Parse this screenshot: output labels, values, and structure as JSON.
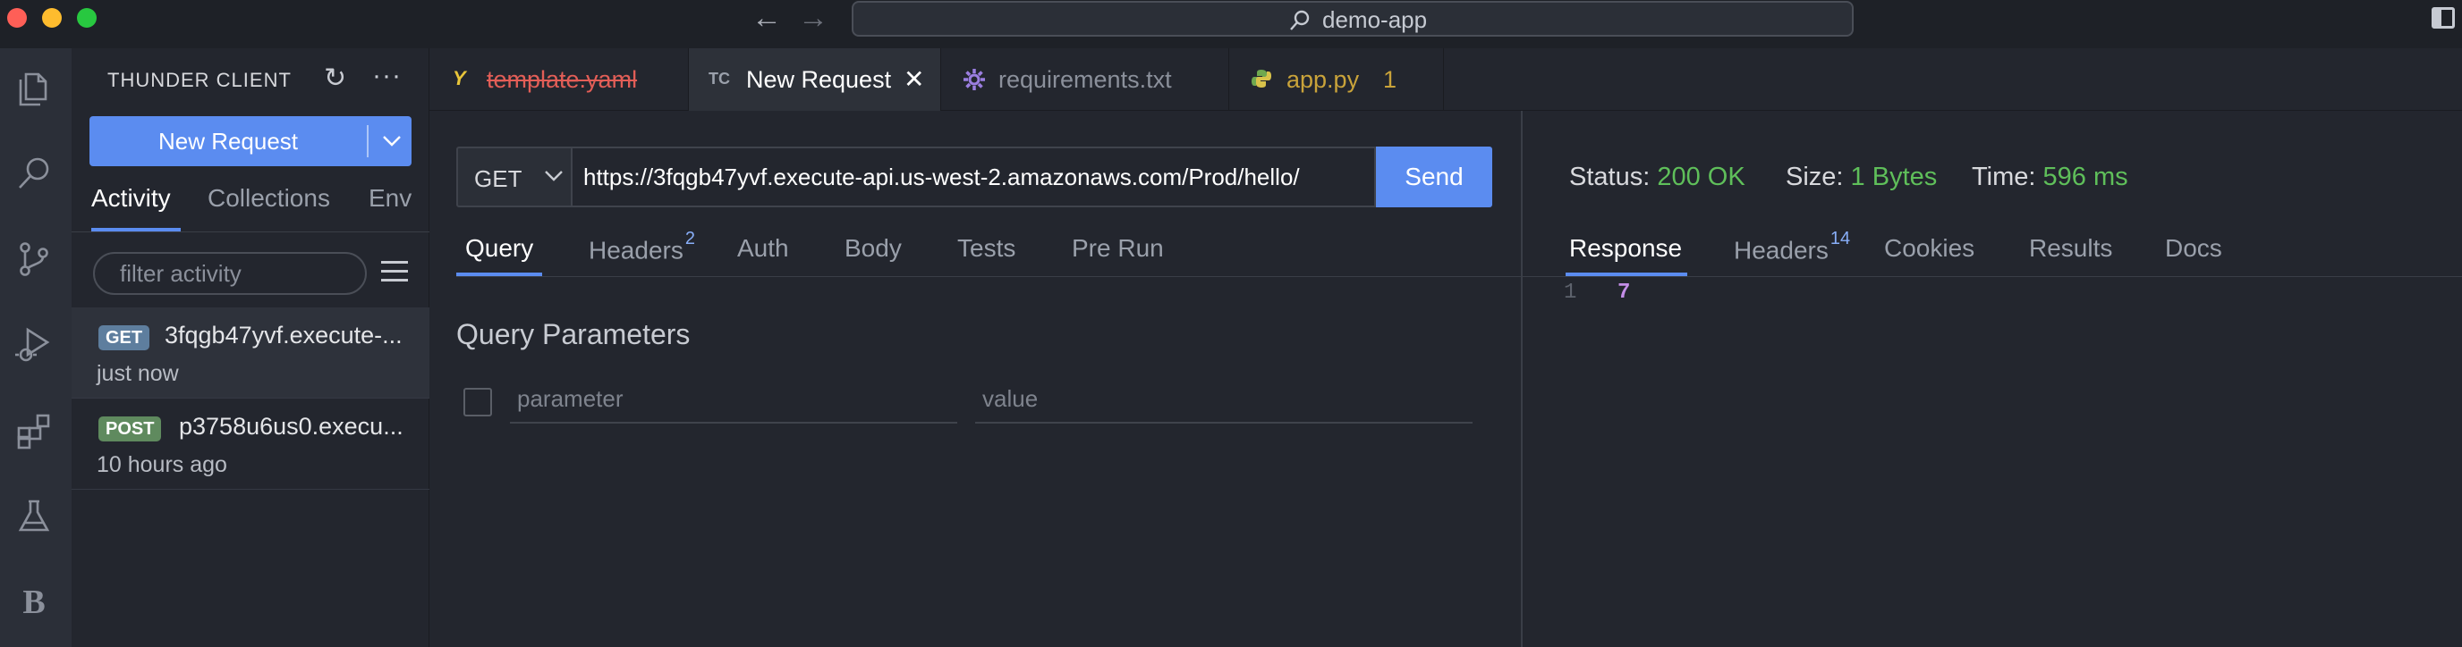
{
  "titlebar": {
    "search_text": "demo-app"
  },
  "activitybar": {
    "items": [
      "explorer-icon",
      "search-icon",
      "source-control-icon",
      "run-debug-icon",
      "extensions-icon",
      "testing-icon",
      "b-icon"
    ],
    "b_label": "B"
  },
  "sidebar": {
    "title": "THUNDER CLIENT",
    "new_request_label": "New Request",
    "tabs": [
      {
        "label": "Activity",
        "active": true
      },
      {
        "label": "Collections",
        "active": false
      },
      {
        "label": "Env",
        "active": false
      }
    ],
    "filter_placeholder": "filter activity",
    "history": [
      {
        "method": "GET",
        "url": "3fqgb47yvf.execute-...",
        "time": "just now",
        "selected": true
      },
      {
        "method": "POST",
        "url": "p3758u6us0.execu...",
        "time": "10 hours ago",
        "selected": false
      }
    ]
  },
  "editor_tabs": [
    {
      "icon": "Y",
      "name": "template.yaml",
      "active": false
    },
    {
      "icon": "TC",
      "name": "New Request",
      "active": true
    },
    {
      "icon": "gear-icon",
      "name": "requirements.txt",
      "active": false
    },
    {
      "icon": "python-icon",
      "name": "app.py",
      "badge": "1",
      "active": false
    }
  ],
  "request": {
    "method": "GET",
    "url": "https://3fqgb47yvf.execute-api.us-west-2.amazonaws.com/Prod/hello/",
    "send_label": "Send",
    "tabs": [
      {
        "label": "Query",
        "active": true
      },
      {
        "label": "Headers",
        "count": "2"
      },
      {
        "label": "Auth"
      },
      {
        "label": "Body"
      },
      {
        "label": "Tests"
      },
      {
        "label": "Pre Run"
      }
    ],
    "query_title": "Query Parameters",
    "param_placeholder": "parameter",
    "value_placeholder": "value"
  },
  "response": {
    "status_label": "Status:",
    "status_value": "200 OK",
    "size_label": "Size:",
    "size_value": "1 Bytes",
    "time_label": "Time:",
    "time_value": "596 ms",
    "tabs": [
      {
        "label": "Response",
        "active": true
      },
      {
        "label": "Headers",
        "count": "14"
      },
      {
        "label": "Cookies"
      },
      {
        "label": "Results"
      },
      {
        "label": "Docs"
      }
    ],
    "line_number": "1",
    "body": "7"
  },
  "colors": {
    "accent": "#5b8cf0",
    "success": "#5fbf5a",
    "background": "#23262e"
  }
}
